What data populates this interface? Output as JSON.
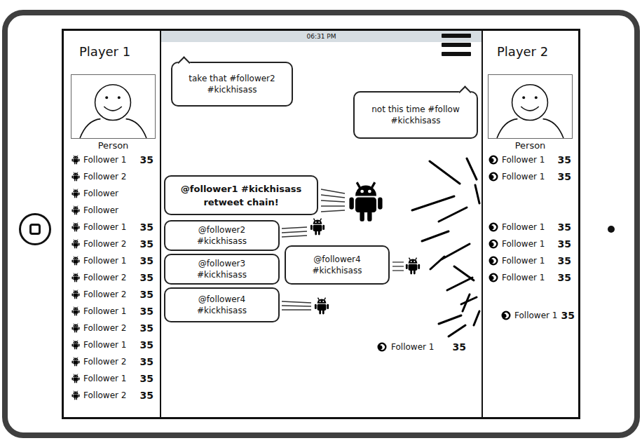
{
  "status_bar": {
    "time": "06:31 PM"
  },
  "players": [
    {
      "name": "Player 1",
      "caption": "Person",
      "kind": "android",
      "followers": [
        {
          "name": "Follower 1",
          "count": "35",
          "slot": "in"
        },
        {
          "name": "Follower 2",
          "slot": "in"
        },
        {
          "name": "Follower",
          "slot": "in"
        },
        {
          "name": "Follower",
          "slot": "in"
        },
        {
          "name": "Follower 1",
          "count": "35",
          "slot": "in"
        },
        {
          "name": "Follower 2",
          "count": "35",
          "slot": "in"
        },
        {
          "name": "Follower 1",
          "count": "35",
          "slot": "in"
        },
        {
          "name": "Follower 2",
          "count": "35",
          "slot": "in"
        },
        {
          "name": "Follower 2",
          "count": "35",
          "slot": "in"
        },
        {
          "name": "Follower 1",
          "count": "35",
          "slot": "in"
        },
        {
          "name": "Follower 2",
          "count": "35",
          "slot": "in"
        },
        {
          "name": "Follower 1",
          "count": "35",
          "slot": "in"
        },
        {
          "name": "Follower 2",
          "count": "35",
          "slot": "in"
        },
        {
          "name": "Follower 1",
          "count": "35",
          "slot": "in"
        },
        {
          "name": "Follower 2",
          "count": "35",
          "slot": "in"
        }
      ]
    },
    {
      "name": "Player 2",
      "caption": "Person",
      "kind": "swirl",
      "followers": [
        {
          "name": "Follower 1",
          "count": "35",
          "slot": "in"
        },
        {
          "name": "Follower 1",
          "count": "35",
          "slot": "in"
        },
        {
          "slot": "empty"
        },
        {
          "slot": "empty"
        },
        {
          "name": "Follower 1",
          "count": "35",
          "slot": "in"
        },
        {
          "name": "Follower 1",
          "count": "35",
          "slot": "in"
        },
        {
          "name": "Follower 1",
          "count": "35",
          "slot": "in"
        },
        {
          "name": "Follower 1",
          "count": "35",
          "slot": "in"
        },
        {
          "slot": "empty"
        },
        {
          "name": "Follower 1",
          "count": "35",
          "slot": "leaving"
        }
      ]
    }
  ],
  "taunts": [
    {
      "lines": [
        "take that #follower2",
        "#kickhisass"
      ]
    },
    {
      "lines": [
        "not this time #follow",
        "#kickhisass"
      ]
    }
  ],
  "retweet_chain": {
    "lines": [
      "@follower1 #kickhisass",
      "retweet chain!"
    ]
  },
  "retweets": [
    {
      "lines": [
        "@follower2",
        "#kickhisass"
      ]
    },
    {
      "lines": [
        "@follower3",
        "#kickhisass"
      ]
    },
    {
      "lines": [
        "@follower4",
        "#kickhisass"
      ]
    },
    {
      "lines": [
        "@follower4",
        "#kickhisass"
      ]
    }
  ],
  "knocked_out": [
    {
      "name": "Follower 1",
      "count": "35",
      "kind": "swirl"
    }
  ]
}
